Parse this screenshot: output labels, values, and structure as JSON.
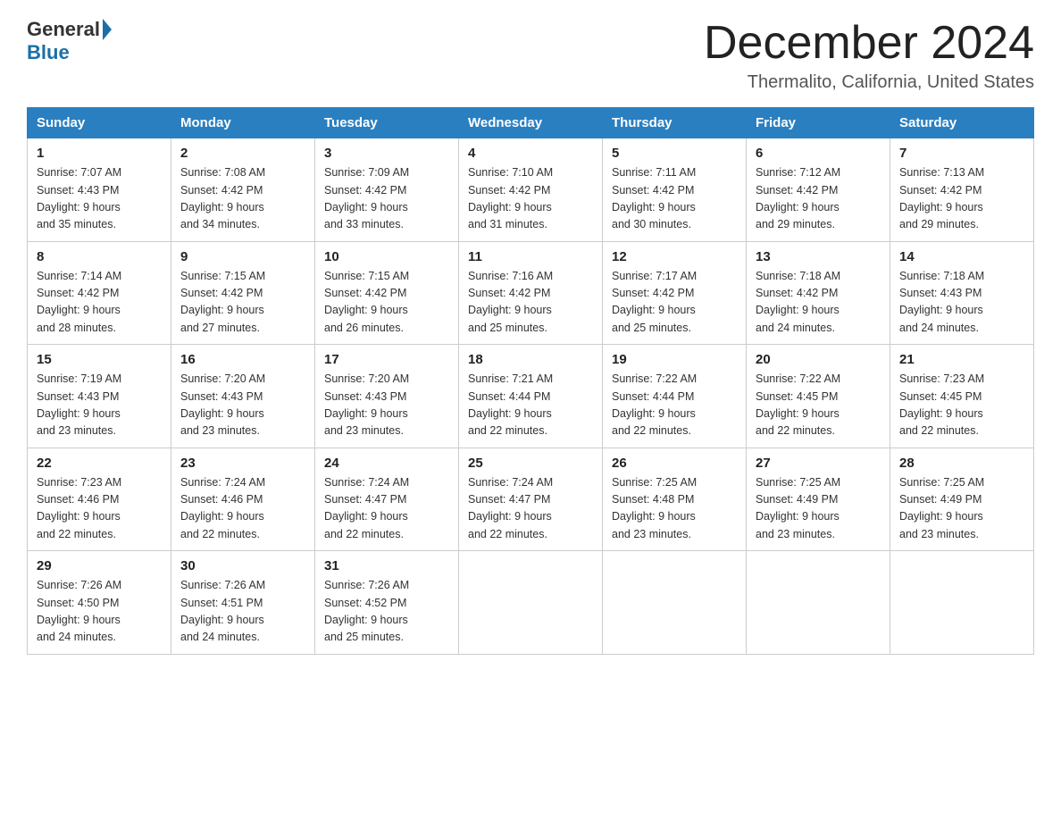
{
  "header": {
    "logo_general": "General",
    "logo_blue": "Blue",
    "month_title": "December 2024",
    "location": "Thermalito, California, United States"
  },
  "weekdays": [
    "Sunday",
    "Monday",
    "Tuesday",
    "Wednesday",
    "Thursday",
    "Friday",
    "Saturday"
  ],
  "weeks": [
    [
      {
        "day": "1",
        "sunrise": "7:07 AM",
        "sunset": "4:43 PM",
        "daylight": "9 hours and 35 minutes."
      },
      {
        "day": "2",
        "sunrise": "7:08 AM",
        "sunset": "4:42 PM",
        "daylight": "9 hours and 34 minutes."
      },
      {
        "day": "3",
        "sunrise": "7:09 AM",
        "sunset": "4:42 PM",
        "daylight": "9 hours and 33 minutes."
      },
      {
        "day": "4",
        "sunrise": "7:10 AM",
        "sunset": "4:42 PM",
        "daylight": "9 hours and 31 minutes."
      },
      {
        "day": "5",
        "sunrise": "7:11 AM",
        "sunset": "4:42 PM",
        "daylight": "9 hours and 30 minutes."
      },
      {
        "day": "6",
        "sunrise": "7:12 AM",
        "sunset": "4:42 PM",
        "daylight": "9 hours and 29 minutes."
      },
      {
        "day": "7",
        "sunrise": "7:13 AM",
        "sunset": "4:42 PM",
        "daylight": "9 hours and 29 minutes."
      }
    ],
    [
      {
        "day": "8",
        "sunrise": "7:14 AM",
        "sunset": "4:42 PM",
        "daylight": "9 hours and 28 minutes."
      },
      {
        "day": "9",
        "sunrise": "7:15 AM",
        "sunset": "4:42 PM",
        "daylight": "9 hours and 27 minutes."
      },
      {
        "day": "10",
        "sunrise": "7:15 AM",
        "sunset": "4:42 PM",
        "daylight": "9 hours and 26 minutes."
      },
      {
        "day": "11",
        "sunrise": "7:16 AM",
        "sunset": "4:42 PM",
        "daylight": "9 hours and 25 minutes."
      },
      {
        "day": "12",
        "sunrise": "7:17 AM",
        "sunset": "4:42 PM",
        "daylight": "9 hours and 25 minutes."
      },
      {
        "day": "13",
        "sunrise": "7:18 AM",
        "sunset": "4:42 PM",
        "daylight": "9 hours and 24 minutes."
      },
      {
        "day": "14",
        "sunrise": "7:18 AM",
        "sunset": "4:43 PM",
        "daylight": "9 hours and 24 minutes."
      }
    ],
    [
      {
        "day": "15",
        "sunrise": "7:19 AM",
        "sunset": "4:43 PM",
        "daylight": "9 hours and 23 minutes."
      },
      {
        "day": "16",
        "sunrise": "7:20 AM",
        "sunset": "4:43 PM",
        "daylight": "9 hours and 23 minutes."
      },
      {
        "day": "17",
        "sunrise": "7:20 AM",
        "sunset": "4:43 PM",
        "daylight": "9 hours and 23 minutes."
      },
      {
        "day": "18",
        "sunrise": "7:21 AM",
        "sunset": "4:44 PM",
        "daylight": "9 hours and 22 minutes."
      },
      {
        "day": "19",
        "sunrise": "7:22 AM",
        "sunset": "4:44 PM",
        "daylight": "9 hours and 22 minutes."
      },
      {
        "day": "20",
        "sunrise": "7:22 AM",
        "sunset": "4:45 PM",
        "daylight": "9 hours and 22 minutes."
      },
      {
        "day": "21",
        "sunrise": "7:23 AM",
        "sunset": "4:45 PM",
        "daylight": "9 hours and 22 minutes."
      }
    ],
    [
      {
        "day": "22",
        "sunrise": "7:23 AM",
        "sunset": "4:46 PM",
        "daylight": "9 hours and 22 minutes."
      },
      {
        "day": "23",
        "sunrise": "7:24 AM",
        "sunset": "4:46 PM",
        "daylight": "9 hours and 22 minutes."
      },
      {
        "day": "24",
        "sunrise": "7:24 AM",
        "sunset": "4:47 PM",
        "daylight": "9 hours and 22 minutes."
      },
      {
        "day": "25",
        "sunrise": "7:24 AM",
        "sunset": "4:47 PM",
        "daylight": "9 hours and 22 minutes."
      },
      {
        "day": "26",
        "sunrise": "7:25 AM",
        "sunset": "4:48 PM",
        "daylight": "9 hours and 23 minutes."
      },
      {
        "day": "27",
        "sunrise": "7:25 AM",
        "sunset": "4:49 PM",
        "daylight": "9 hours and 23 minutes."
      },
      {
        "day": "28",
        "sunrise": "7:25 AM",
        "sunset": "4:49 PM",
        "daylight": "9 hours and 23 minutes."
      }
    ],
    [
      {
        "day": "29",
        "sunrise": "7:26 AM",
        "sunset": "4:50 PM",
        "daylight": "9 hours and 24 minutes."
      },
      {
        "day": "30",
        "sunrise": "7:26 AM",
        "sunset": "4:51 PM",
        "daylight": "9 hours and 24 minutes."
      },
      {
        "day": "31",
        "sunrise": "7:26 AM",
        "sunset": "4:52 PM",
        "daylight": "9 hours and 25 minutes."
      },
      null,
      null,
      null,
      null
    ]
  ],
  "labels": {
    "sunrise": "Sunrise:",
    "sunset": "Sunset:",
    "daylight": "Daylight:"
  }
}
